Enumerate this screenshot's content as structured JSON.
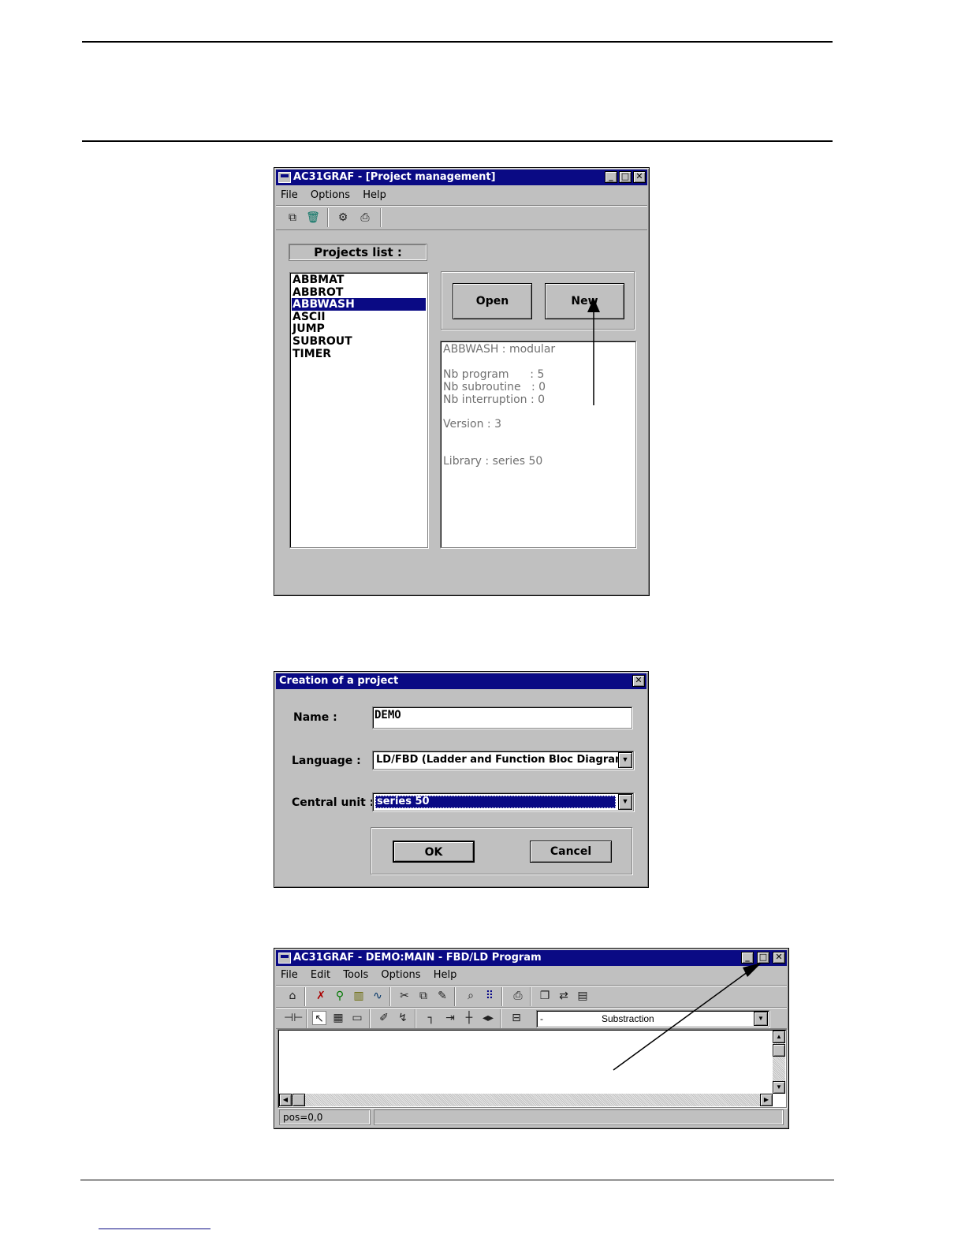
{
  "project_window": {
    "title": "AC31GRAF  - [Project management]",
    "menu": [
      "File",
      "Options",
      "Help"
    ],
    "toolbar_icons": [
      "copy-icon",
      "trash-icon",
      "compile-icon",
      "print-icon"
    ],
    "projects_list_label": "Projects list :",
    "projects": [
      "ABBMAT",
      "ABBROT",
      "ABBWASH",
      "ASCII",
      "JUMP",
      "SUBROUT",
      "TIMER"
    ],
    "selected_project": "ABBWASH",
    "open_label": "Open",
    "new_label": "New",
    "info": {
      "header": "ABBWASH : modular",
      "nb_program": "Nb program      : 5",
      "nb_subroutine": "Nb subroutine   : 0",
      "nb_interruption": "Nb interruption : 0",
      "version": "Version : 3",
      "library": "Library : series 50"
    }
  },
  "creation_dialog": {
    "title": "Creation of a project",
    "name_label": "Name :",
    "name_value": "DEMO",
    "language_label": "Language :",
    "language_value": "LD/FBD (Ladder and Function Bloc Diagram)",
    "central_unit_label": "Central unit :",
    "central_unit_value": "series 50",
    "ok_label": "OK",
    "cancel_label": "Cancel"
  },
  "program_window": {
    "title": "AC31GRAF - DEMO:MAIN - FBD/LD Program",
    "menu": [
      "File",
      "Edit",
      "Tools",
      "Options",
      "Help"
    ],
    "combo_prefix": "-",
    "combo_value": "Substraction",
    "status_pos": "pos=0,0"
  }
}
